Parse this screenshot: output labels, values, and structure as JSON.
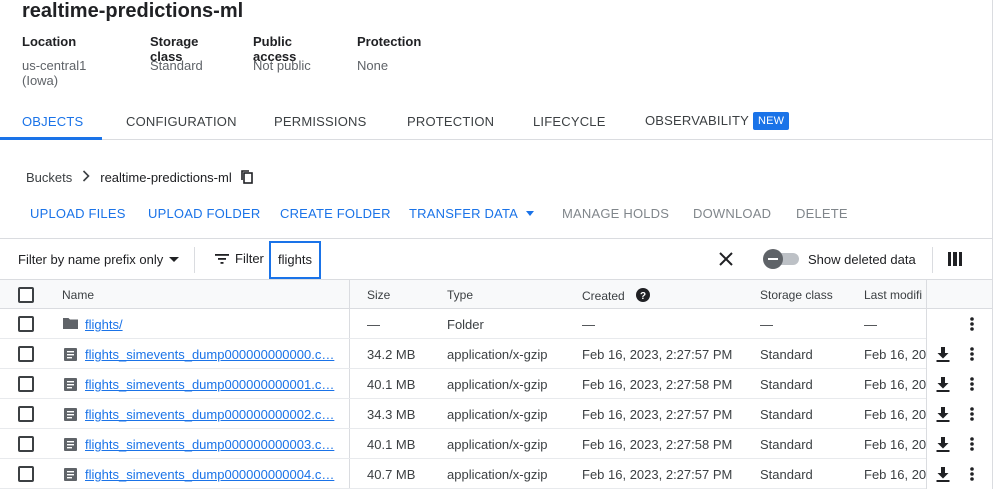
{
  "bucket": {
    "title": "realtime-predictions-ml",
    "meta": [
      {
        "label": "Location",
        "value": "us-central1 (Iowa)"
      },
      {
        "label": "Storage class",
        "value": "Standard"
      },
      {
        "label": "Public access",
        "value": "Not public"
      },
      {
        "label": "Protection",
        "value": "None"
      }
    ]
  },
  "tabs": [
    {
      "label": "OBJECTS",
      "active": true
    },
    {
      "label": "CONFIGURATION"
    },
    {
      "label": "PERMISSIONS"
    },
    {
      "label": "PROTECTION"
    },
    {
      "label": "LIFECYCLE"
    },
    {
      "label": "OBSERVABILITY",
      "badge": "NEW"
    }
  ],
  "breadcrumb": {
    "root": "Buckets",
    "current": "realtime-predictions-ml"
  },
  "actions": {
    "upload_files": "UPLOAD FILES",
    "upload_folder": "UPLOAD FOLDER",
    "create_folder": "CREATE FOLDER",
    "transfer_data": "TRANSFER DATA",
    "manage_holds": "MANAGE HOLDS",
    "download": "DOWNLOAD",
    "delete": "DELETE"
  },
  "filter": {
    "mode": "Filter by name prefix only",
    "label": "Filter",
    "value": "flights",
    "show_deleted": "Show deleted data",
    "show_deleted_on": false
  },
  "table": {
    "headers": {
      "name": "Name",
      "size": "Size",
      "type": "Type",
      "created": "Created",
      "storage_class": "Storage class",
      "last_modified": "Last modifi"
    },
    "rows": [
      {
        "name": "flights/",
        "size": "—",
        "type": "Folder",
        "created": "—",
        "storage": "—",
        "modified": "—",
        "kind": "folder"
      },
      {
        "name": "flights_simevents_dump000000000000.c…",
        "size": "34.2 MB",
        "type": "application/x-gzip",
        "created": "Feb 16, 2023, 2:27:57 PM",
        "storage": "Standard",
        "modified": "Feb 16, 20",
        "kind": "file"
      },
      {
        "name": "flights_simevents_dump000000000001.c…",
        "size": "40.1 MB",
        "type": "application/x-gzip",
        "created": "Feb 16, 2023, 2:27:58 PM",
        "storage": "Standard",
        "modified": "Feb 16, 20",
        "kind": "file"
      },
      {
        "name": "flights_simevents_dump000000000002.c…",
        "size": "34.3 MB",
        "type": "application/x-gzip",
        "created": "Feb 16, 2023, 2:27:57 PM",
        "storage": "Standard",
        "modified": "Feb 16, 20",
        "kind": "file"
      },
      {
        "name": "flights_simevents_dump000000000003.c…",
        "size": "40.1 MB",
        "type": "application/x-gzip",
        "created": "Feb 16, 2023, 2:27:58 PM",
        "storage": "Standard",
        "modified": "Feb 16, 20",
        "kind": "file"
      },
      {
        "name": "flights_simevents_dump000000000004.c…",
        "size": "40.7 MB",
        "type": "application/x-gzip",
        "created": "Feb 16, 2023, 2:27:57 PM",
        "storage": "Standard",
        "modified": "Feb 16, 20",
        "kind": "file"
      }
    ]
  },
  "colors": {
    "accent": "#1a73e8",
    "text": "#202124",
    "muted": "#5f6368",
    "border": "#dadce0"
  },
  "icons": {
    "copy": "copy-icon",
    "chevron": "chevron-right-icon",
    "filter": "filter-icon",
    "clear": "close-icon",
    "columns": "column-display-icon",
    "help": "help-icon",
    "folder": "folder-icon",
    "file": "file-icon",
    "download": "download-icon",
    "more": "more-vert-icon"
  }
}
